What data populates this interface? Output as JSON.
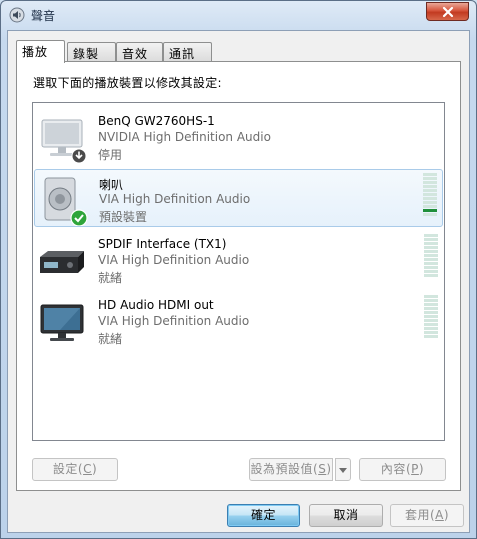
{
  "window": {
    "title": "聲音"
  },
  "tabs": [
    {
      "label": "播放",
      "active": true
    },
    {
      "label": "錄製",
      "active": false
    },
    {
      "label": "音效",
      "active": false
    },
    {
      "label": "通訊",
      "active": false
    }
  ],
  "instruction": "選取下面的播放裝置以修改其設定:",
  "devices": [
    {
      "name": "BenQ GW2760HS-1",
      "driver": "NVIDIA High Definition Audio",
      "status": "停用",
      "icon": "monitor-icon",
      "badge": "down-arrow-badge",
      "selected": false,
      "level": 0
    },
    {
      "name": "喇叭",
      "driver": "VIA High Definition Audio",
      "status": "預設裝置",
      "icon": "speaker-icon",
      "badge": "green-check-badge",
      "selected": true,
      "level": 0.2
    },
    {
      "name": "SPDIF Interface (TX1)",
      "driver": "VIA High Definition Audio",
      "status": "就緒",
      "icon": "receiver-icon",
      "badge": "",
      "selected": false,
      "level": 0
    },
    {
      "name": "HD Audio HDMI out",
      "driver": "VIA High Definition Audio",
      "status": "就緒",
      "icon": "monitor-icon",
      "badge": "",
      "selected": false,
      "level": 0
    }
  ],
  "panel_buttons": {
    "configure": {
      "label": "設定",
      "key": "C",
      "enabled": false
    },
    "set_default": {
      "label": "設為預設值",
      "key": "S",
      "enabled": false
    },
    "properties": {
      "label": "內容",
      "key": "P",
      "enabled": false
    }
  },
  "dialog_buttons": {
    "ok": {
      "label": "確定"
    },
    "cancel": {
      "label": "取消"
    },
    "apply": {
      "label": "套用",
      "key": "A",
      "enabled": false
    }
  },
  "colors": {
    "meter_on": "#1f8f3a",
    "meter_off": "#d2e6de",
    "selection": "#e6f1fb",
    "close": "#c23a21"
  }
}
